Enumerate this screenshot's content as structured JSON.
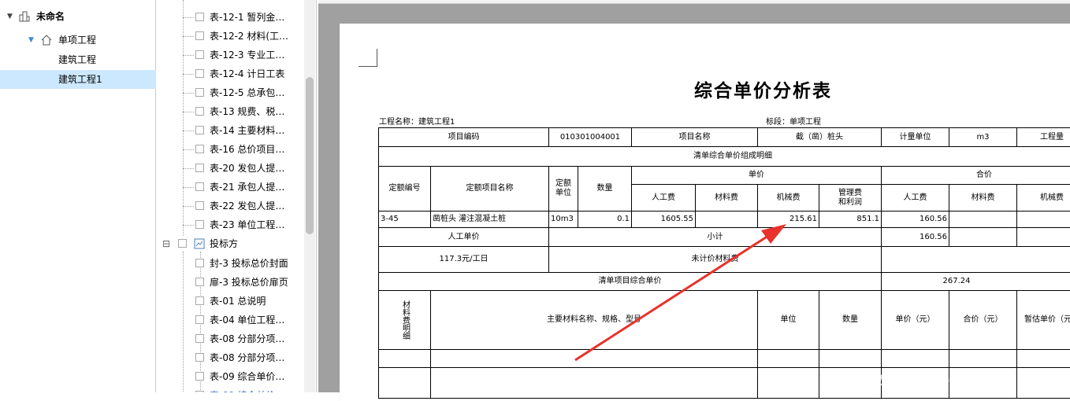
{
  "project_tree": {
    "root": "未命名",
    "single_project": "单项工程",
    "units": [
      "建筑工程",
      "建筑工程1"
    ]
  },
  "report_list": {
    "items_before": [
      "表-12-1 暂列金…",
      "表-12-2 材料(工…",
      "表-12-3 专业工…",
      "表-12-4 计日工表",
      "表-12-5 总承包…",
      "表-13 规费、税…",
      "表-14 主要材料…",
      "表-16 总价项目…",
      "表-20 发包人提…",
      "表-21 承包人提…",
      "表-22 发包人提…",
      "表-23 单位工程…"
    ],
    "group_label": "投标方",
    "group_collapse": "⊟",
    "items_after": [
      "封-3 投标总价封面",
      "扉-3 投标总价扉页",
      "表-01 总说明",
      "表-04 单位工程…",
      "表-08 分部分项…",
      "表-08 分部分项…",
      "表-09 综合单价…",
      "表-09 综合单价…"
    ]
  },
  "report": {
    "title": "综合单价分析表",
    "project_name": "工程名称：建筑工程1",
    "section": "标段：单项工程",
    "row1": {
      "code_label": "项目编码",
      "code": "010301004001",
      "name_label": "项目名称",
      "name": "截（凿）桩头",
      "unit_label": "计量单位",
      "unit": "m3",
      "qty_label": "工程量"
    },
    "detail_header": "清单综合单价组成明细",
    "col": {
      "quota_no": "定额编号",
      "quota_name": "定额项目名称",
      "quota_unit": "定额单位",
      "qty": "数量",
      "unit_price": "单价",
      "total_price": "合价",
      "labor": "人工费",
      "material": "材料费",
      "machine": "机械费",
      "mgmt": "管理费和利润"
    },
    "row_detail": {
      "no": "3-45",
      "name": "凿桩头 灌注混凝土桩",
      "unit": "10m3",
      "qty": "0.1",
      "labor": "1605.55",
      "material": "",
      "machine": "215.61",
      "mgmt": "851.1",
      "t_labor": "160.56"
    },
    "labor_rate_label": "人工单价",
    "subtotal_label": "小计",
    "subtotal_labor": "160.56",
    "labor_rate": "117.3元/工日",
    "unpriced_label": "未计价材料费",
    "composite_label": "清单项目综合单价",
    "composite_value": "267.24",
    "mat_detail_label": "材料费明细",
    "mat_cols": {
      "name": "主要材料名称、规格、型号",
      "unit": "单位",
      "qty": "数量",
      "price": "单价（元）",
      "total": "合价（元）",
      "est": "暂估单价（元）"
    }
  },
  "watermark": "激活 Windows",
  "colors": {
    "selected": "#cce8ff",
    "arrow": "#e8322b",
    "preview_bg": "#a0a0a0"
  }
}
